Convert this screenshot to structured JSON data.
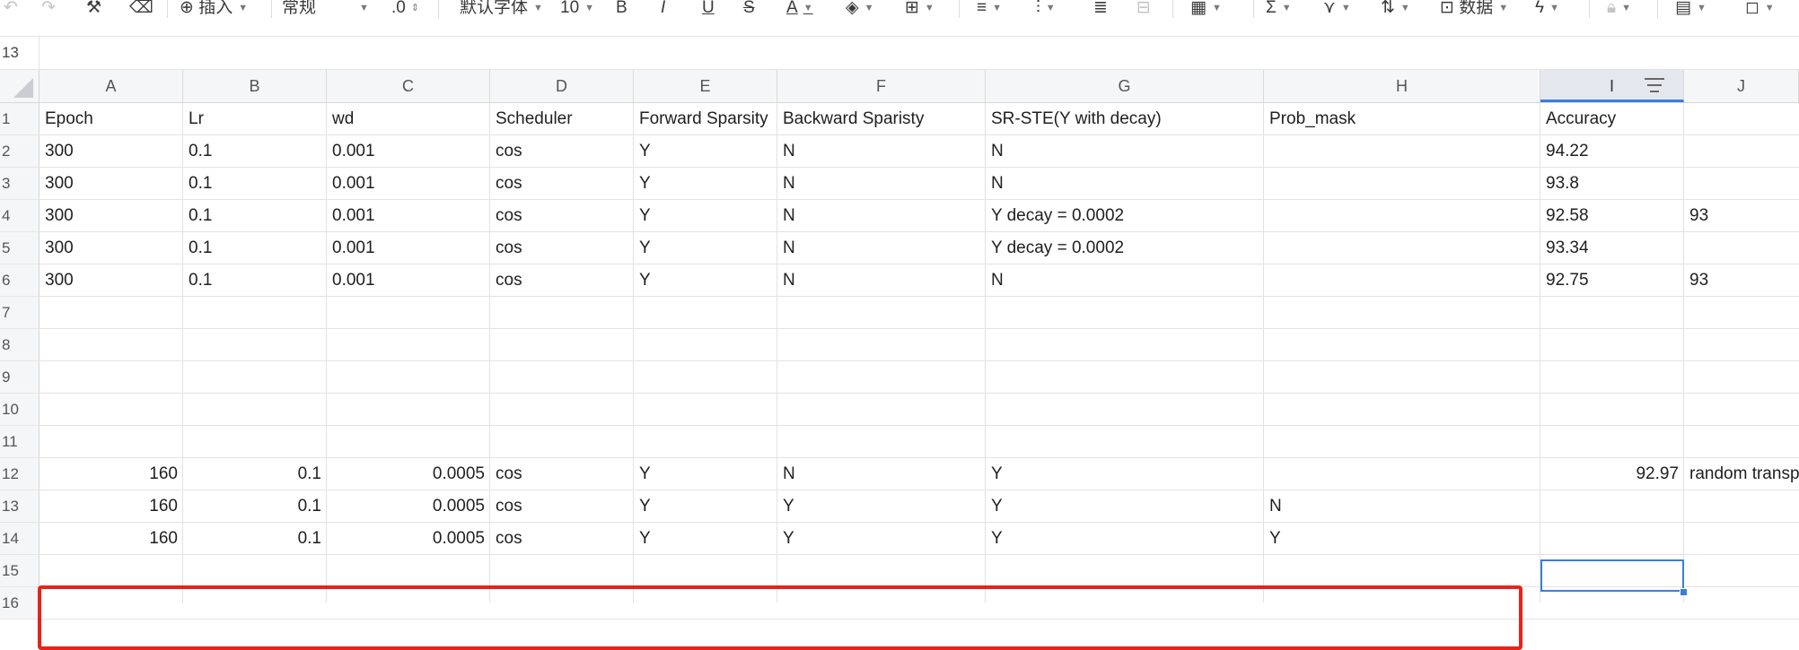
{
  "toolbar": {
    "undo_icon": "undo-icon",
    "redo_icon": "redo-icon",
    "format_painter_icon": "format-painter-icon",
    "eraser_icon": "eraser-icon",
    "insert_label": "插入",
    "number_format_label": "常规",
    "decimal_label": ".0",
    "font_label": "默认字体",
    "font_size_label": "10",
    "bold_label": "B",
    "italic_label": "I",
    "underline_label": "U",
    "strike_label": "S",
    "font_color_label": "A",
    "data_label": "数据"
  },
  "name_box": {
    "row_ref": "13"
  },
  "columns": [
    {
      "id": "A",
      "label": "A"
    },
    {
      "id": "B",
      "label": "B"
    },
    {
      "id": "C",
      "label": "C"
    },
    {
      "id": "D",
      "label": "D"
    },
    {
      "id": "E",
      "label": "E"
    },
    {
      "id": "F",
      "label": "F"
    },
    {
      "id": "G",
      "label": "G"
    },
    {
      "id": "H",
      "label": "H"
    },
    {
      "id": "I",
      "label": "I"
    },
    {
      "id": "J",
      "label": "J"
    }
  ],
  "rows": [
    "1",
    "2",
    "3",
    "4",
    "5",
    "6",
    "7",
    "8",
    "9",
    "10",
    "11",
    "12",
    "13",
    "14",
    "15",
    "16"
  ],
  "cells": {
    "r1": [
      "Epoch",
      "Lr",
      "wd",
      "Scheduler",
      "Forward Sparsity",
      "Backward Sparisty",
      "SR-STE(Y  with decay)",
      "Prob_mask",
      "Accuracy",
      ""
    ],
    "r2": [
      "300",
      "0.1",
      "0.001",
      "cos",
      "Y",
      "N",
      "N",
      "",
      "94.22",
      ""
    ],
    "r3": [
      "300",
      "0.1",
      "0.001",
      "cos",
      "Y",
      "N",
      "N",
      "",
      "93.8",
      ""
    ],
    "r4": [
      "300",
      "0.1",
      "0.001",
      "cos",
      "Y",
      "N",
      "Y  decay = 0.0002",
      "",
      "92.58",
      "93"
    ],
    "r5": [
      "300",
      "0.1",
      "0.001",
      "cos",
      "Y",
      "N",
      "Y  decay = 0.0002",
      "",
      "93.34",
      ""
    ],
    "r6": [
      "300",
      "0.1",
      "0.001",
      "cos",
      "Y",
      "N",
      "N",
      "",
      "92.75",
      "93"
    ],
    "r12": [
      "160",
      "0.1",
      "0.0005",
      "cos",
      "Y",
      "N",
      "Y",
      "",
      "92.97",
      "random transp"
    ],
    "r13": [
      "160",
      "0.1",
      "0.0005",
      "cos",
      "Y",
      "Y",
      "Y",
      "N",
      "",
      ""
    ],
    "r14": [
      "160",
      "0.1",
      "0.0005",
      "cos",
      "Y",
      "Y",
      "Y",
      "Y",
      "",
      ""
    ]
  },
  "selection": {
    "column": "I",
    "row": "13"
  },
  "colors": {
    "selection": "#3b7ddd",
    "highlight": "#e8221b",
    "header_bg": "#f5f6f7"
  }
}
